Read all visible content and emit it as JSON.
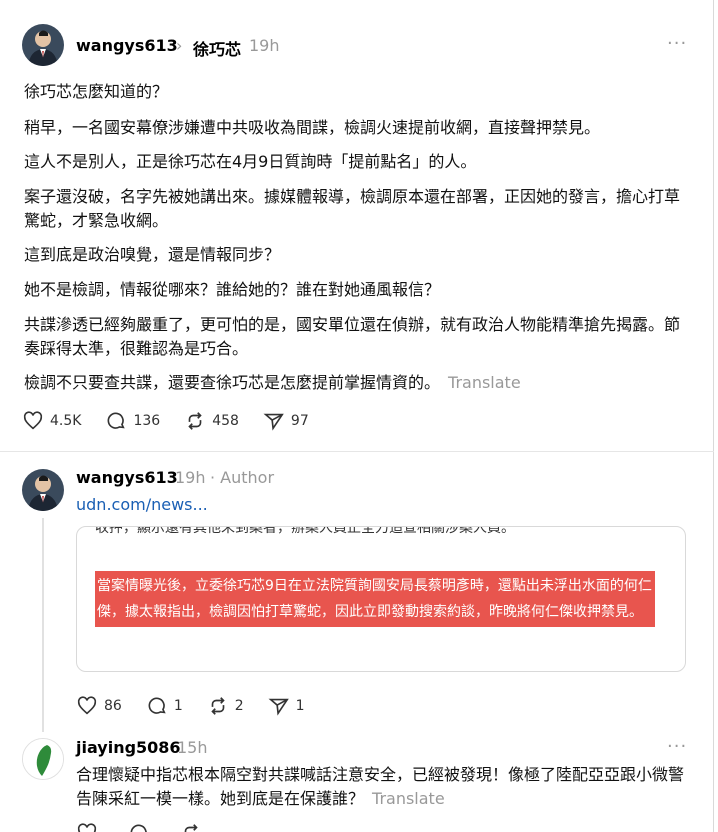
{
  "post": {
    "username": "wangys613",
    "mention": "徐巧芯",
    "time": "19h",
    "paragraphs": [
      "徐巧芯怎麼知道的？",
      "稍早，一名國安幕僚涉嫌遭中共吸收為間諜，檢調火速提前收網，直接聲押禁見。",
      "這人不是別人，正是徐巧芯在4月9日質詢時「提前點名」的人。",
      "案子還沒破，名字先被她講出來。據媒體報導，檢調原本還在部署，正因她的發言，擔心打草驚蛇，才緊急收網。",
      "這到底是政治嗅覺，還是情報同步？",
      "她不是檢調，情報從哪來？誰給她的？誰在對她通風報信？",
      "共諜滲透已經夠嚴重了，更可怕的是，國安單位還在偵辦，就有政治人物能精準搶先揭露。節奏踩得太準，很難認為是巧合。",
      "檢調不只要查共諜，還要查徐巧芯是怎麼提前掌握情資的。"
    ],
    "translate": "Translate",
    "likes": "4.5K",
    "comments": "136",
    "reposts": "458",
    "shares": "97"
  },
  "reply1": {
    "username": "wangys613",
    "time": "19h",
    "author_tag": "· Author",
    "link": "udn.com/news...",
    "embed_top": "收押，顯示還有其他未到案者，辦案人員正全力追查相關涉案人員。",
    "embed_highlight": "當案情曝光後，立委徐巧芯9日在立法院質詢國安局長蔡明彥時，還點出未浮出水面的何仁傑，據太報指出，檢調因怕打草驚蛇，因此立即發動搜索約談，昨晚將何仁傑收押禁見。",
    "likes": "86",
    "comments": "1",
    "reposts": "2",
    "shares": "1"
  },
  "reply2": {
    "username": "jiaying5086",
    "time": "15h",
    "text": "合理懷疑中指芯根本隔空對共諜喊話注意安全，已經被發現！像極了陸配亞亞跟小微警告陳采紅一模一樣。她到底是在保護誰？",
    "translate": "Translate"
  },
  "icons": {
    "more": "more-icon",
    "like": "heart-icon",
    "comment": "comment-icon",
    "repost": "repost-icon",
    "share": "share-icon",
    "chevron": "chevron-right-icon"
  },
  "colors": {
    "highlight": "#e8554e",
    "muted": "#999999",
    "link": "#1a5fb4"
  }
}
